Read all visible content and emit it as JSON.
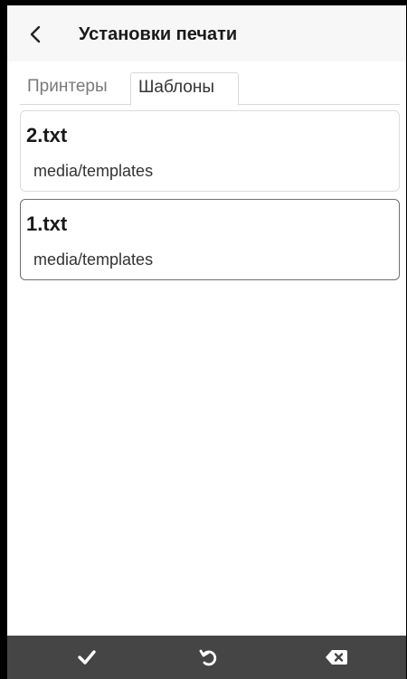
{
  "header": {
    "title": "Установки печати",
    "back_icon": "chevron-left-icon"
  },
  "tabs": [
    {
      "label": "Принтеры",
      "active": false
    },
    {
      "label": "Шаблоны",
      "active": true
    }
  ],
  "templates": [
    {
      "name": "2.txt",
      "path": "media/templates",
      "selected": false
    },
    {
      "name": "1.txt",
      "path": "media/templates",
      "selected": true
    }
  ],
  "bottom_bar": {
    "background": "#454545",
    "icons": [
      "check-icon",
      "undo-icon",
      "backspace-icon"
    ]
  }
}
